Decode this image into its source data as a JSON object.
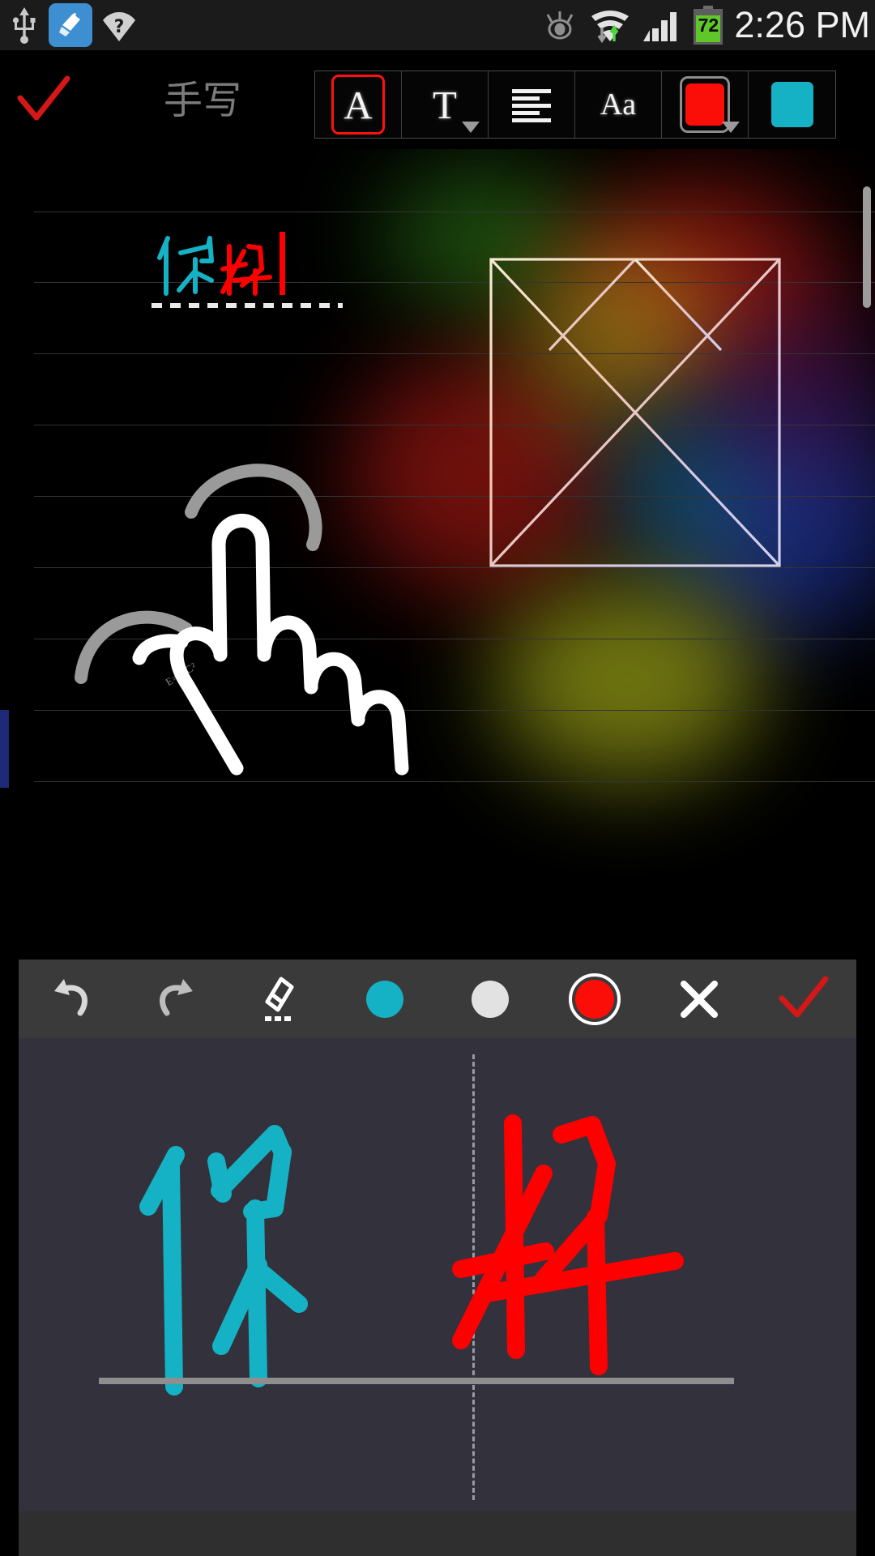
{
  "status_bar": {
    "icons_left": [
      "usb-icon",
      "cleaner-app-icon",
      "wifi-question-icon"
    ],
    "icons_right": [
      "eye-smart-stay-icon",
      "wifi-signal-icon",
      "cellular-signal-icon"
    ],
    "battery_level": "72",
    "clock": "2:26 PM"
  },
  "toolbar": {
    "confirm_label": "✓",
    "title": "手写",
    "buttons": [
      {
        "name": "text-style-a",
        "glyph": "A",
        "selected": true,
        "has_caret": false
      },
      {
        "name": "text-format-t",
        "glyph": "T",
        "selected": false,
        "has_caret": true
      },
      {
        "name": "paragraph-align",
        "glyph": "align",
        "selected": false,
        "has_caret": false
      },
      {
        "name": "font-size-aa",
        "glyph": "Aa",
        "selected": false,
        "has_caret": false
      },
      {
        "name": "text-color-swatch",
        "glyph": "swatch",
        "color": "#fb0d08",
        "selected": false,
        "has_caret": true
      },
      {
        "name": "highlight-color-swatch",
        "glyph": "swatch",
        "color": "#14b2c4",
        "selected": false,
        "has_caret": false
      }
    ],
    "collapse_icon": "chevron-down-icon"
  },
  "canvas": {
    "inserted_text": "你好",
    "inserted_text_colors": {
      "first": "#14b2c4",
      "second": "#ff0000"
    },
    "cursor_color": "#ff0000",
    "annotation_label": "E=MC²",
    "ruled_line_color": "#343434",
    "ruled_line_count": 9,
    "drawing_names": [
      "hand-sketch",
      "tangram-sketch"
    ],
    "left_marker_color": "#1e2a78",
    "scrollbar": "vertical-scrollbar"
  },
  "pen_toolbar": {
    "buttons": [
      {
        "name": "undo-button",
        "icon": "undo-icon"
      },
      {
        "name": "redo-button",
        "icon": "redo-icon"
      },
      {
        "name": "eraser-button",
        "icon": "eraser-icon"
      },
      {
        "name": "color-cyan-button",
        "icon": "color-dot",
        "color": "#14b2c4",
        "selected": false
      },
      {
        "name": "color-white-button",
        "icon": "color-dot",
        "color": "#e2e2e2",
        "selected": false
      },
      {
        "name": "color-red-button",
        "icon": "color-dot",
        "color": "#fb0d08",
        "selected": true
      },
      {
        "name": "cancel-button",
        "icon": "close-x-icon"
      },
      {
        "name": "accept-button",
        "icon": "check-icon"
      }
    ]
  },
  "handwriting_panel": {
    "stroke_char_left": "你",
    "stroke_char_right": "好",
    "stroke_color_left": "#14b2c4",
    "stroke_color_right": "#ff0000",
    "background": "#32313c",
    "divider": "cell-divider-dashed",
    "baseline": "writing-baseline"
  }
}
